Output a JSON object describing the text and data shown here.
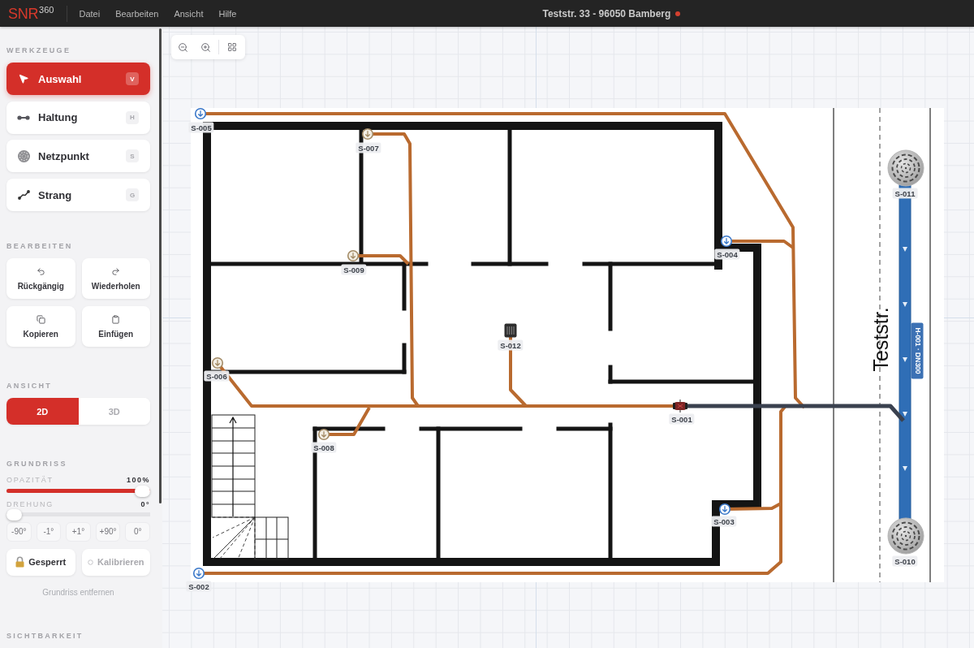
{
  "app": {
    "logo": "SNR$^{360}$"
  },
  "menu": [
    "Datei",
    "Bearbeiten",
    "Ansicht",
    "Hilfe"
  ],
  "document": {
    "title": "Teststr. 33 - 96050 Bamberg",
    "modified": true
  },
  "sidebar": {
    "tools": {
      "heading": "WERKZEUGE",
      "items": [
        {
          "label": "Auswahl",
          "shortcut": "V",
          "kind": "select",
          "selected": true
        },
        {
          "label": "Haltung",
          "shortcut": "H",
          "kind": "pipe",
          "selected": false
        },
        {
          "label": "Netzpunkt",
          "shortcut": "S",
          "kind": "node",
          "selected": false
        },
        {
          "label": "Strang",
          "shortcut": "G",
          "kind": "line",
          "selected": false
        }
      ]
    },
    "edit": {
      "heading": "BEARBEITEN",
      "actions": [
        {
          "label": "Rückgängig",
          "kind": "undo"
        },
        {
          "label": "Wiederholen",
          "kind": "redo"
        },
        {
          "label": "Kopieren",
          "kind": "copy"
        },
        {
          "label": "Einfügen",
          "kind": "paste"
        }
      ]
    },
    "view": {
      "heading": "ANSICHT",
      "modes": [
        {
          "label": "2D",
          "selected": true
        },
        {
          "label": "3D",
          "selected": false
        }
      ]
    },
    "floorplan": {
      "heading": "GRUNDRISS",
      "sliders": [
        {
          "label": "OPAZITÄT",
          "reading": "100%",
          "level": 1
        },
        {
          "label": "DREHUNG",
          "reading": "0°",
          "level": 0
        }
      ],
      "rotate_buttons": [
        "-90°",
        "-1°",
        "+1°",
        "+90°",
        "0°"
      ],
      "lock": {
        "label": "Gesperrt",
        "locked": true
      },
      "calibrate": {
        "label": "Kalibrieren",
        "disabled": true
      },
      "remove": "Grundriss entfernen"
    },
    "visibility": {
      "heading": "SICHTBARKEIT"
    }
  },
  "canvas": {
    "street": "Teststr.",
    "main_pipe": "H-001 · DN300",
    "nodes": [
      {
        "label": "S-005",
        "kind": "downpipe"
      },
      {
        "label": "S-007",
        "kind": "drain"
      },
      {
        "label": "S-011",
        "kind": "manhole"
      },
      {
        "label": "S-004",
        "kind": "downpipe"
      },
      {
        "label": "S-009",
        "kind": "drain"
      },
      {
        "label": "S-012",
        "kind": "gully"
      },
      {
        "label": "S-006",
        "kind": "drain"
      },
      {
        "label": "S-001",
        "kind": "valve"
      },
      {
        "label": "S-008",
        "kind": "drain"
      },
      {
        "label": "S-003",
        "kind": "downpipe"
      },
      {
        "label": "S-010",
        "kind": "manhole"
      },
      {
        "label": "S-002",
        "kind": "downpipe"
      }
    ]
  }
}
